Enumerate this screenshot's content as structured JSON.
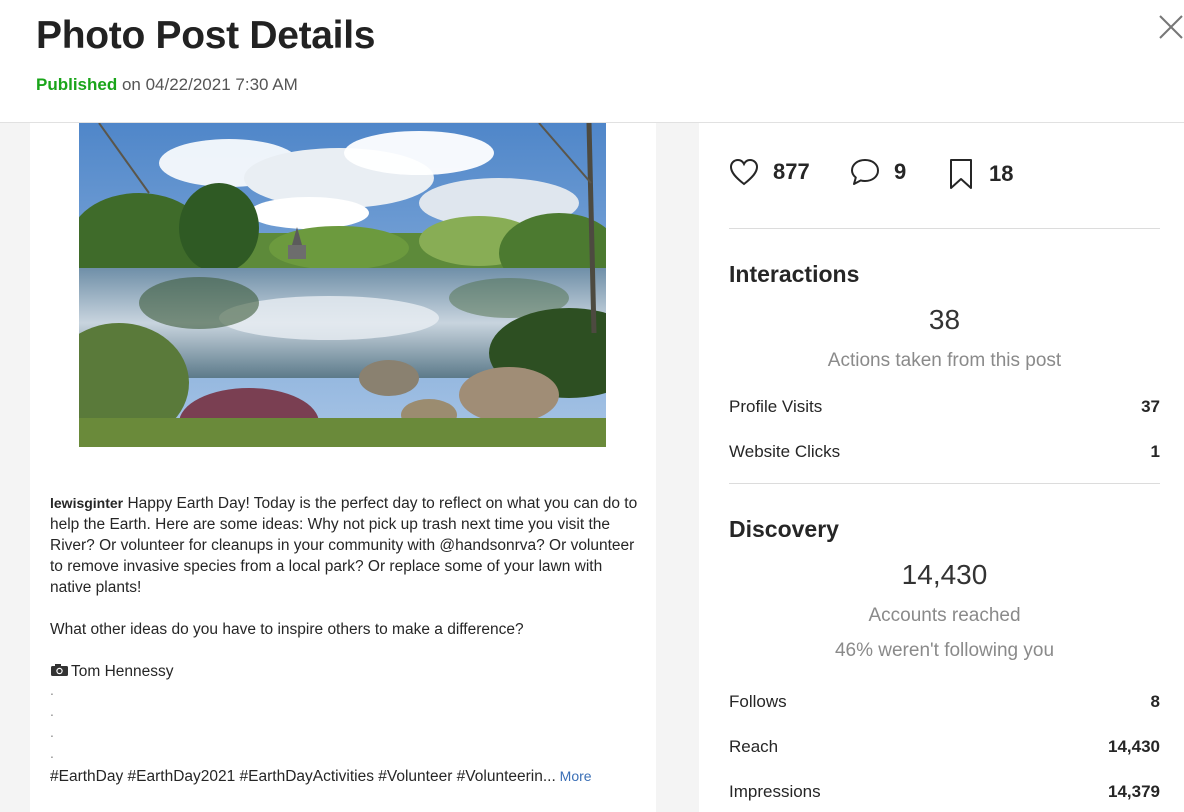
{
  "header": {
    "title": "Photo Post Details",
    "status": "Published",
    "date_text": " on 04/22/2021 7:30 AM",
    "close_icon": "close-icon"
  },
  "post": {
    "username": "lewisginter",
    "caption_intro": " Happy Earth Day! Today is the perfect day to reflect on what you can do to help the Earth.  Here are some ideas: Why not pick up trash next time you visit the River? Or volunteer for cleanups in your community with @handsonrva? Or volunteer to remove invasive species from a local park? Or replace some of your lawn with native plants!",
    "caption_question": "What other ideas do you have to inspire others to make a difference?",
    "camera_icon": "camera-icon",
    "photo_credit": "Tom Hennessy",
    "dots": [
      ".",
      ".",
      ".",
      "."
    ],
    "hashtags": "#EarthDay #EarthDay2021 #EarthDayActivities #Volunteer #Volunteerin...",
    "more_label": " More"
  },
  "stats": {
    "likes": "877",
    "comments": "9",
    "saves": "18",
    "icons": [
      "heart-icon",
      "comment-icon",
      "bookmark-icon"
    ]
  },
  "interactions": {
    "title": "Interactions",
    "total": "38",
    "subtitle": "Actions taken from this post",
    "rows": [
      {
        "label": "Profile Visits",
        "value": "37"
      },
      {
        "label": "Website Clicks",
        "value": "1"
      }
    ]
  },
  "discovery": {
    "title": "Discovery",
    "total": "14,430",
    "subtitle": "Accounts reached",
    "note": "46% weren't following you",
    "rows": [
      {
        "label": "Follows",
        "value": "8"
      },
      {
        "label": "Reach",
        "value": "14,430"
      },
      {
        "label": "Impressions",
        "value": "14,379"
      }
    ]
  },
  "colors": {
    "published": "#1aa51a",
    "link": "#3b6fb6",
    "panel_bg": "#f4f4f4"
  }
}
